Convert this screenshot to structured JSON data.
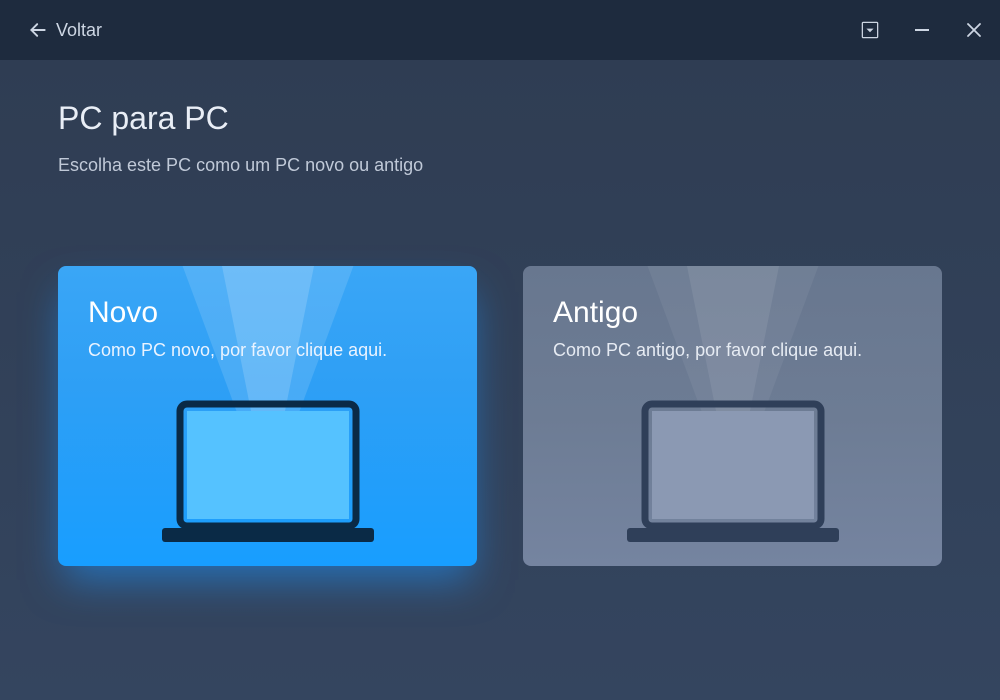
{
  "titlebar": {
    "back_label": "Voltar"
  },
  "page": {
    "title": "PC para PC",
    "subtitle": "Escolha este PC como um PC novo ou antigo"
  },
  "cards": {
    "new": {
      "title": "Novo",
      "desc": "Como PC novo, por favor clique aqui."
    },
    "old": {
      "title": "Antigo",
      "desc": "Como PC antigo, por favor clique aqui."
    }
  }
}
